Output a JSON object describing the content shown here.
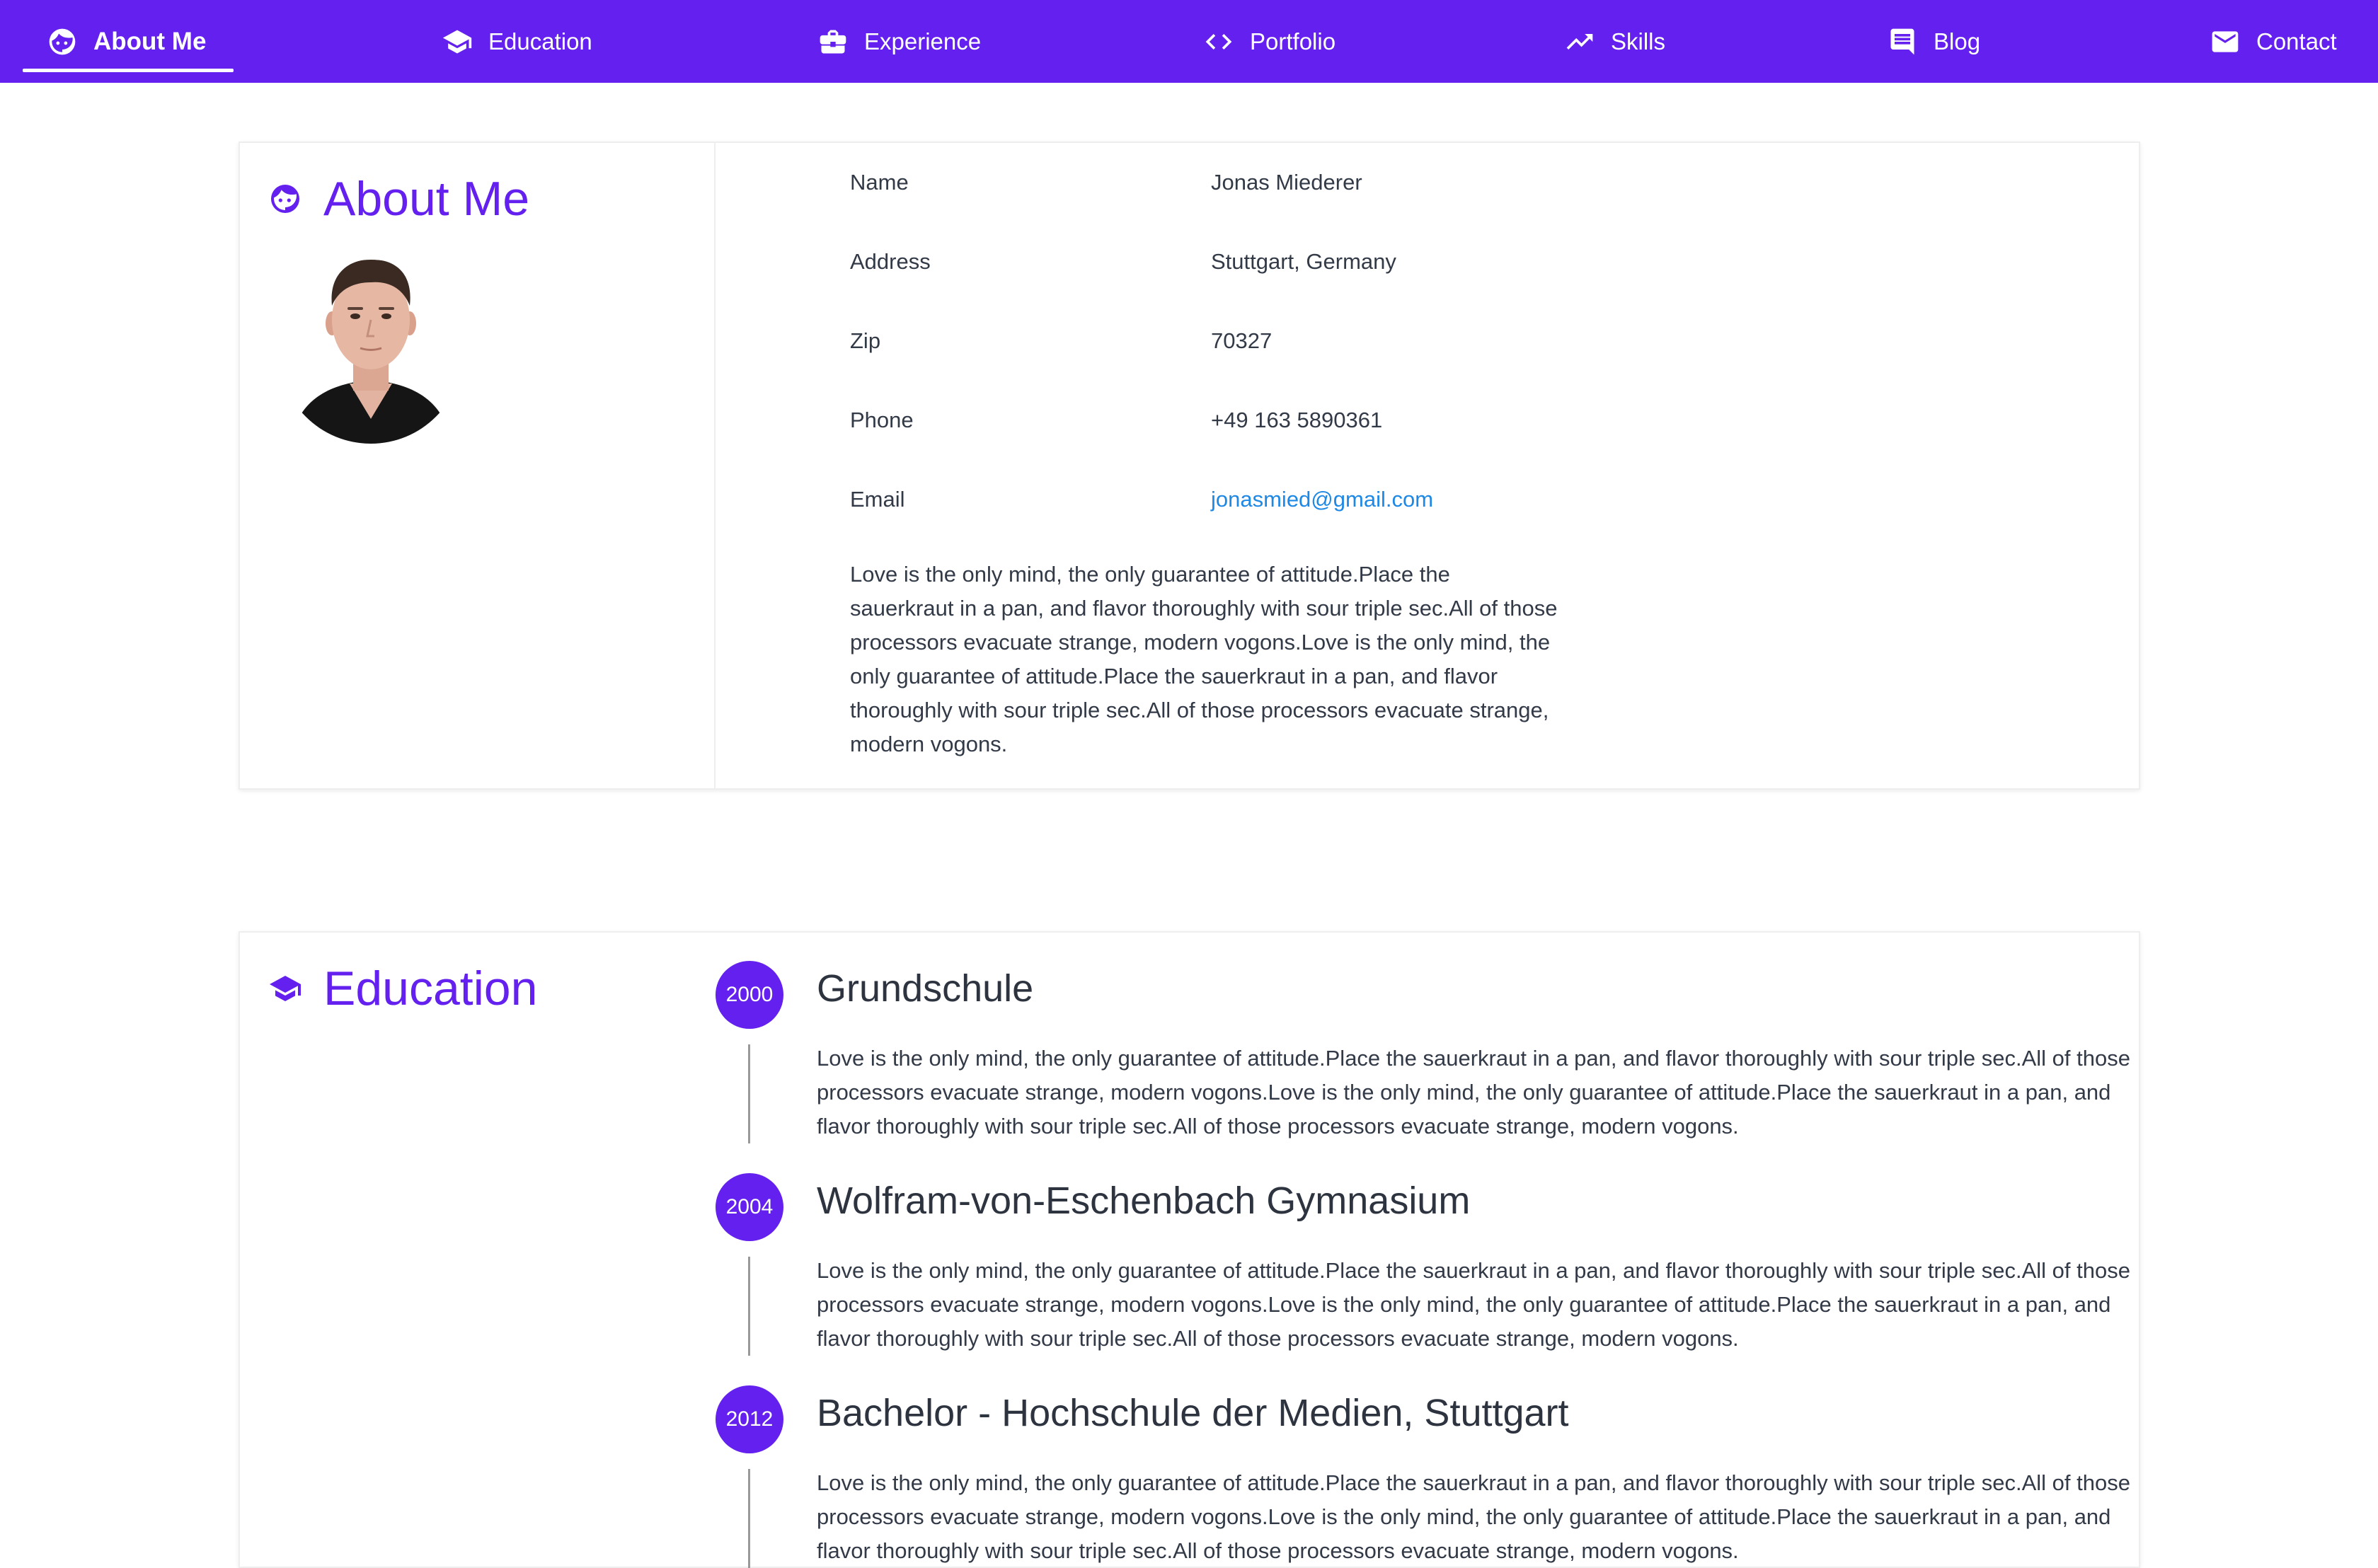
{
  "nav": {
    "items": [
      {
        "label": "About Me",
        "icon": "face-icon",
        "active": true
      },
      {
        "label": "Education",
        "icon": "graduation-cap-icon"
      },
      {
        "label": "Experience",
        "icon": "briefcase-icon"
      },
      {
        "label": "Portfolio",
        "icon": "code-icon"
      },
      {
        "label": "Skills",
        "icon": "trending-up-icon"
      },
      {
        "label": "Blog",
        "icon": "comment-icon"
      },
      {
        "label": "Contact",
        "icon": "mail-icon"
      }
    ],
    "accent": "#6320ee"
  },
  "about": {
    "title": "About Me",
    "rows": [
      {
        "label": "Name",
        "value": "Jonas Miederer"
      },
      {
        "label": "Address",
        "value": "Stuttgart, Germany"
      },
      {
        "label": "Zip",
        "value": "70327"
      },
      {
        "label": "Phone",
        "value": "+49 163 5890361"
      },
      {
        "label": "Email",
        "value": "jonasmied@gmail.com"
      }
    ],
    "bio": "Love is the only mind, the only guarantee of attitude.Place the sauerkraut in a pan, and flavor thoroughly with sour triple sec.All of those processors evacuate strange, modern vogons.Love is the only mind, the only guarantee of attitude.Place the sauerkraut in a pan, and flavor thoroughly with sour triple sec.All of those processors evacuate strange, modern vogons."
  },
  "education": {
    "title": "Education",
    "entries": [
      {
        "year": "2000",
        "title": "Grundschule",
        "text": "Love is the only mind, the only guarantee of attitude.Place the sauerkraut in a pan, and flavor thoroughly with sour triple sec.All of those processors evacuate strange, modern vogons.Love is the only mind, the only guarantee of attitude.Place the sauerkraut in a pan, and flavor thoroughly with sour triple sec.All of those processors evacuate strange, modern vogons."
      },
      {
        "year": "2004",
        "title": "Wolfram-von-Eschenbach Gymnasium",
        "text": "Love is the only mind, the only guarantee of attitude.Place the sauerkraut in a pan, and flavor thoroughly with sour triple sec.All of those processors evacuate strange, modern vogons.Love is the only mind, the only guarantee of attitude.Place the sauerkraut in a pan, and flavor thoroughly with sour triple sec.All of those processors evacuate strange, modern vogons."
      },
      {
        "year": "2012",
        "title": "Bachelor - Hochschule der Medien, Stuttgart",
        "text": "Love is the only mind, the only guarantee of attitude.Place the sauerkraut in a pan, and flavor thoroughly with sour triple sec.All of those processors evacuate strange, modern vogons.Love is the only mind, the only guarantee of attitude.Place the sauerkraut in a pan, and flavor thoroughly with sour triple sec.All of those processors evacuate strange, modern vogons."
      }
    ]
  }
}
